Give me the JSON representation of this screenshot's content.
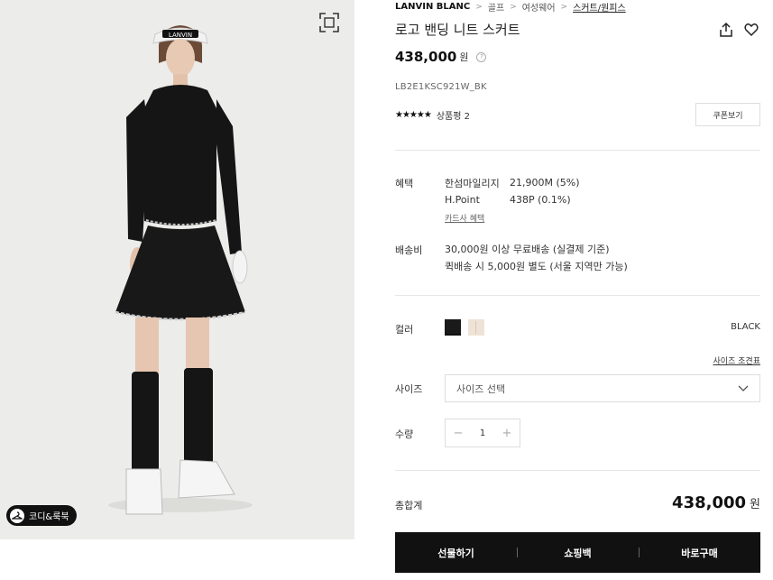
{
  "breadcrumb": {
    "brand": "LANVIN BLANC",
    "items": [
      "골프",
      "여성웨어",
      "스커트/원피스"
    ]
  },
  "product": {
    "title": "로고 밴딩 니트 스커트",
    "price": "438,000",
    "currency": "원",
    "sku": "LB2E1KSC921W_BK",
    "stars": "★★★★★",
    "review_label": "상품평 2",
    "coupon_button": "쿠폰보기"
  },
  "image": {
    "coordi_label": "코디&룩북",
    "visor_text": "LANVIN"
  },
  "benefit": {
    "label": "혜택",
    "rows": [
      {
        "name": "한섬마일리지",
        "value": "21,900M (5%)"
      },
      {
        "name": "H.Point",
        "value": "438P (0.1%)"
      }
    ],
    "card_link": "카드사 혜택"
  },
  "shipping": {
    "label": "배송비",
    "lines": [
      "30,000원 이상 무료배송 (실결제 기준)",
      "퀵배송 시 5,000원 별도 (서울 지역만 가능)"
    ]
  },
  "color": {
    "label": "컬러",
    "selected": "BLACK",
    "options": [
      {
        "name": "black",
        "hex": "#1a1a1a"
      },
      {
        "name": "beige",
        "hex": "#eee3d6"
      }
    ]
  },
  "size": {
    "guide_link": "사이즈 조견표",
    "label": "사이즈",
    "placeholder": "사이즈 선택"
  },
  "quantity": {
    "label": "수량",
    "value": "1",
    "minus": "−",
    "plus": "+"
  },
  "total": {
    "label": "총합계",
    "price": "438,000",
    "currency": "원"
  },
  "actions": {
    "gift": "선물하기",
    "cart": "쇼핑백",
    "buy": "바로구매"
  }
}
